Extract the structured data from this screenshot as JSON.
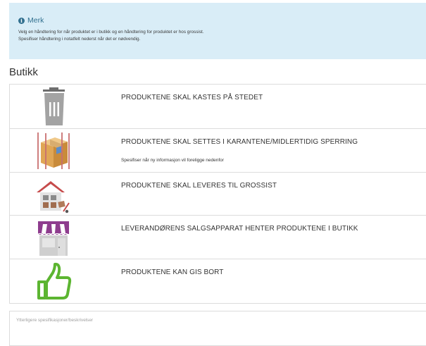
{
  "info": {
    "icon": "info-circle-icon",
    "title": "Merk",
    "lines": [
      "Velg en håndtering for når produktet er i butikk og en håndtering for produktet er hos grossist.",
      "Spesifiser håndtering i notatfelt nederst når det er nødvendig."
    ]
  },
  "section_title": "Butikk",
  "options": [
    {
      "icon": "trash-can-icon",
      "label": "PRODUKTENE SKAL KASTES PÅ STEDET"
    },
    {
      "icon": "quarantine-box-icon",
      "label": "PRODUKTENE SKAL SETTES I KARANTENE/MIDLERTIDIG SPERRING",
      "sub": "Spesifiser når ny informasjon vil foreligge nedenfor"
    },
    {
      "icon": "warehouse-icon",
      "label": "PRODUKTENE SKAL LEVERES TIL GROSSIST"
    },
    {
      "icon": "storefront-icon",
      "label": "LEVERANDØRENS SALGSAPPARAT HENTER PRODUKTENE I BUTIKK"
    },
    {
      "icon": "thumbs-up-icon",
      "label": "PRODUKTENE KAN GIS BORT"
    }
  ],
  "notes": {
    "placeholder": "Ytterligere spesifikasjoner/beskrivelser"
  },
  "colors": {
    "info_bg": "#d9edf7",
    "info_text": "#31708f",
    "thumb_green": "#5cb531",
    "awning_purple": "#8e3c8e"
  }
}
